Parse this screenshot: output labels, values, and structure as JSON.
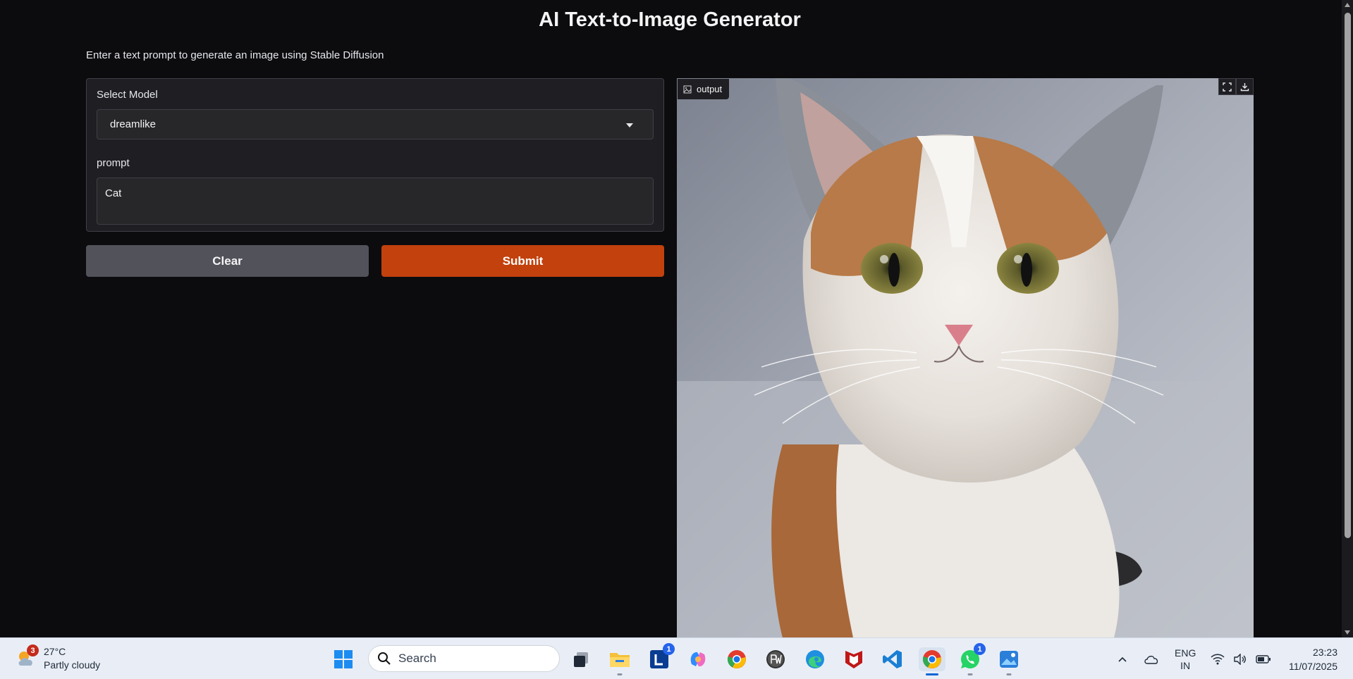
{
  "app": {
    "title": "AI Text-to-Image Generator",
    "subtitle": "Enter a text prompt to generate an image using Stable Diffusion",
    "model_label": "Select Model",
    "model_value": "dreamlike",
    "prompt_label": "prompt",
    "prompt_value": "Cat",
    "clear_label": "Clear",
    "submit_label": "Submit",
    "output_label": "output",
    "accent_color": "#c2410c"
  },
  "taskbar": {
    "weather_badge": "3",
    "weather_temp": "27°C",
    "weather_desc": "Partly cloudy",
    "search_placeholder": "Search",
    "icons": [
      "start-icon",
      "search-icon",
      "task-view-icon",
      "file-explorer-icon",
      "linkedin-learning-icon",
      "copilot-icon",
      "chrome-icon",
      "pw-app-icon",
      "edge-icon",
      "mcafee-icon",
      "vscode-icon",
      "chrome-active-icon",
      "whatsapp-icon",
      "photos-icon"
    ],
    "linkedin_badge": "1",
    "whatsapp_badge": "1",
    "lang_top": "ENG",
    "lang_bottom": "IN",
    "time": "23:23",
    "date": "11/07/2025"
  }
}
